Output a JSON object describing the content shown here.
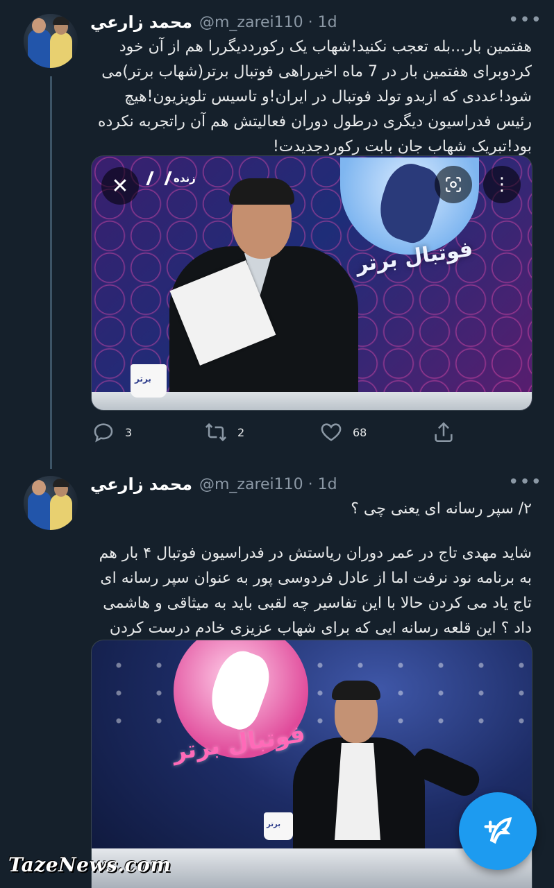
{
  "colors": {
    "background": "#15202b",
    "text_primary": "#e7e9ea",
    "text_secondary": "#8b98a5",
    "accent": "#1d9bf0",
    "thread_line": "#3d5466"
  },
  "tweets": [
    {
      "author": "محمد زارعي",
      "handle": "@m_zarei110 · 1d",
      "more_icon": "more-horizontal-icon",
      "text": "هفتمین بار...بله تعجب نکنید!شهاب یک رکورددیگررا هم از آن خود کردوبرای هفتمین بار در 7 ماه اخیرراهی فوتبال برتر(شهاب برتر)می شود!عددی که ازبدو تولد فوتبال در ایران!و تاسیس تلویزیون!هیچ رئیس فدراسیون دیگری درطول دوران فعالیتش هم آن راتجربه نکرده بود!تبریک شهاب جان بابت رکوردجدیدت!",
      "media": {
        "live_label": "زنده",
        "logo_text": "فوتبال برتر",
        "mug_text": "برتر"
      },
      "actions": {
        "reply_count": "3",
        "retweet_count": "2",
        "like_count": "68"
      }
    },
    {
      "author": "محمد زارعي",
      "handle": "@m_zarei110 · 1d",
      "more_icon": "more-horizontal-icon",
      "text_line1": "۲/ سپر رسانه ای یعنی چی ؟",
      "text_para": "شاید مهدی تاج در عمر دوران ریاستش در فدراسیون فوتبال ۴ بار هم به برنامه نود نرفت اما از عادل فردوسی پور به عنوان سپر رسانه ای تاج یاد می کردن حالا با این تفاسیر چه لقبی باید به میثاقی و هاشمی داد ؟ این قلعه رسانه ایی که برای شهاب عزیزی خادم درست کردن",
      "media": {
        "logo_text": "فوتبال برتر",
        "mug_text": "برتر"
      }
    }
  ],
  "compose_button": {
    "icon": "compose-tweet-icon"
  },
  "watermark": "TazeNews.com"
}
